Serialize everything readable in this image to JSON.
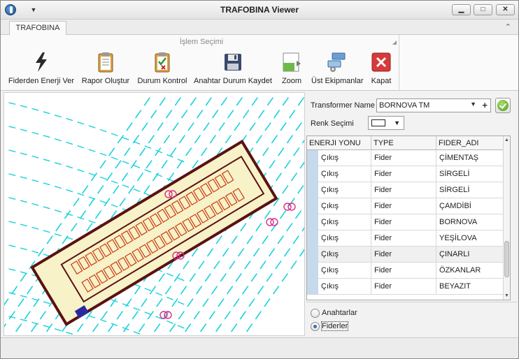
{
  "window": {
    "title": "TRAFOBINA Viewer",
    "minimize_glyph": "▁",
    "maximize_glyph": "□",
    "close_glyph": "✕",
    "qat_glyph": "▼"
  },
  "ribbon": {
    "tab_label": "TRAFOBINA",
    "collapse_glyph": "⌃",
    "group_caption": "İşlem Seçimi",
    "launcher_glyph": "◢",
    "buttons": [
      {
        "label": "Fiderden Enerji Ver",
        "icon": "lightning-icon"
      },
      {
        "label": "Rapor Oluştur",
        "icon": "clipboard-icon"
      },
      {
        "label": "Durum Kontrol",
        "icon": "clipboard-check-icon"
      },
      {
        "label": "Anahtar Durum Kaydet",
        "icon": "floppy-disk-icon"
      },
      {
        "label": "Zoom",
        "icon": "zoom-icon"
      },
      {
        "label": "Üst Ekipmanlar",
        "icon": "network-icon"
      },
      {
        "label": "Kapat",
        "icon": "close-icon"
      }
    ]
  },
  "panel": {
    "transformer_label": "Transformer Name",
    "transformer_value": "BORNOVA TM",
    "dropdown_glyph": "▼",
    "add_glyph": "+",
    "color_label": "Renk Seçimi",
    "color_value": "#ffffff"
  },
  "grid": {
    "columns": [
      "ENERJI YONU",
      "TYPE",
      "FIDER_ADI"
    ],
    "rows": [
      {
        "yon": "Çıkış",
        "type": "Fider",
        "fider": "ÇİMENTAŞ"
      },
      {
        "yon": "Çıkış",
        "type": "Fider",
        "fider": "SİRGELİ"
      },
      {
        "yon": "Çıkış",
        "type": "Fider",
        "fider": "SİRGELİ"
      },
      {
        "yon": "Çıkış",
        "type": "Fider",
        "fider": "ÇAMDİBİ"
      },
      {
        "yon": "Çıkış",
        "type": "Fider",
        "fider": "BORNOVA"
      },
      {
        "yon": "Çıkış",
        "type": "Fider",
        "fider": "YEŞİLOVA"
      },
      {
        "yon": "Çıkış",
        "type": "Fider",
        "fider": "ÇINARLI"
      },
      {
        "yon": "Çıkış",
        "type": "Fider",
        "fider": "ÖZKANLAR"
      },
      {
        "yon": "Çıkış",
        "type": "Fider",
        "fider": "BEYAZIT"
      }
    ],
    "selected_row": 6,
    "scroll_up_glyph": "▲",
    "scroll_down_glyph": "▼"
  },
  "filter": {
    "options": [
      "Anahtarlar",
      "Fiderler"
    ],
    "selected": "Fiderler"
  },
  "colors": {
    "cable": "#18d2dc",
    "building_wall": "#5a1212",
    "building_fill": "#f7f2c8",
    "equipment": "#cc3a12",
    "accent": "#3a6fb0"
  }
}
